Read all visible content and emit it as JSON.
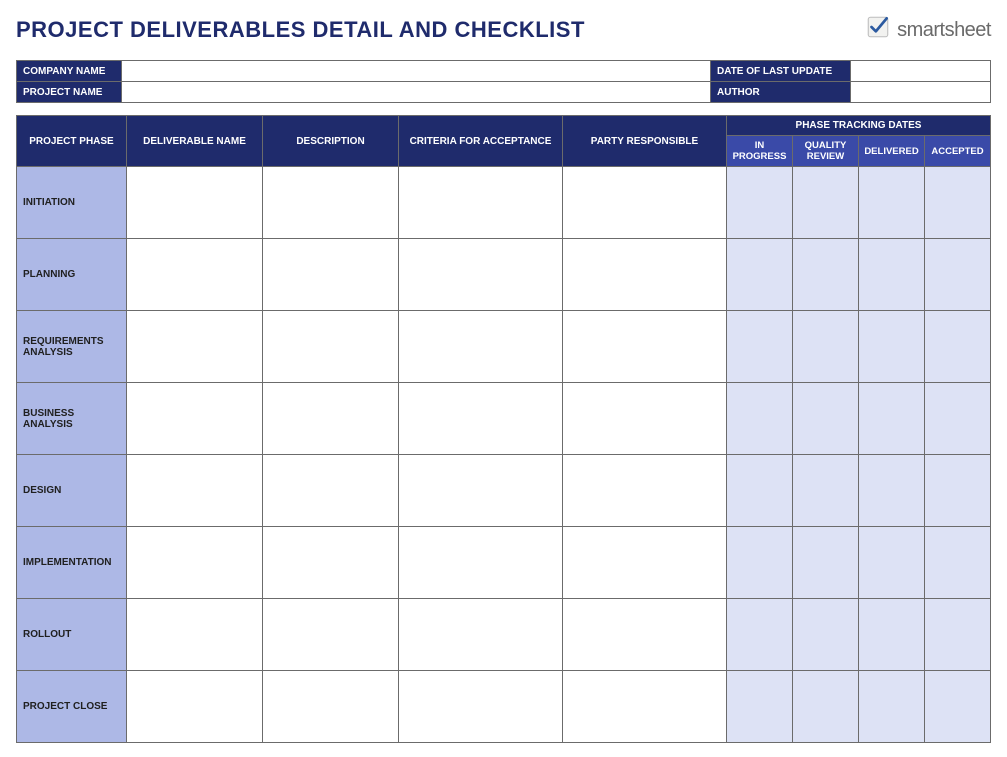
{
  "title": "PROJECT DELIVERABLES DETAIL AND CHECKLIST",
  "brand": "smartsheet",
  "meta": {
    "company_label": "COMPANY NAME",
    "company_value": "",
    "project_label": "PROJECT NAME",
    "project_value": "",
    "date_label": "DATE OF LAST UPDATE",
    "date_value": "",
    "author_label": "AUTHOR",
    "author_value": ""
  },
  "headers": {
    "project_phase": "PROJECT PHASE",
    "deliverable": "DELIVERABLE NAME",
    "description": "DESCRIPTION",
    "criteria": "CRITERIA FOR ACCEPTANCE",
    "party": "PARTY RESPONSIBLE",
    "tracking_group": "PHASE TRACKING DATES",
    "in_progress": "IN PROGRESS",
    "quality": "QUALITY REVIEW",
    "delivered": "DELIVERED",
    "accepted": "ACCEPTED"
  },
  "phases": {
    "0": "INITIATION",
    "1": "PLANNING",
    "2": "REQUIREMENTS ANALYSIS",
    "3": "BUSINESS ANALYSIS",
    "4": "DESIGN",
    "5": "IMPLEMENTATION",
    "6": "ROLLOUT",
    "7": "PROJECT CLOSE"
  }
}
